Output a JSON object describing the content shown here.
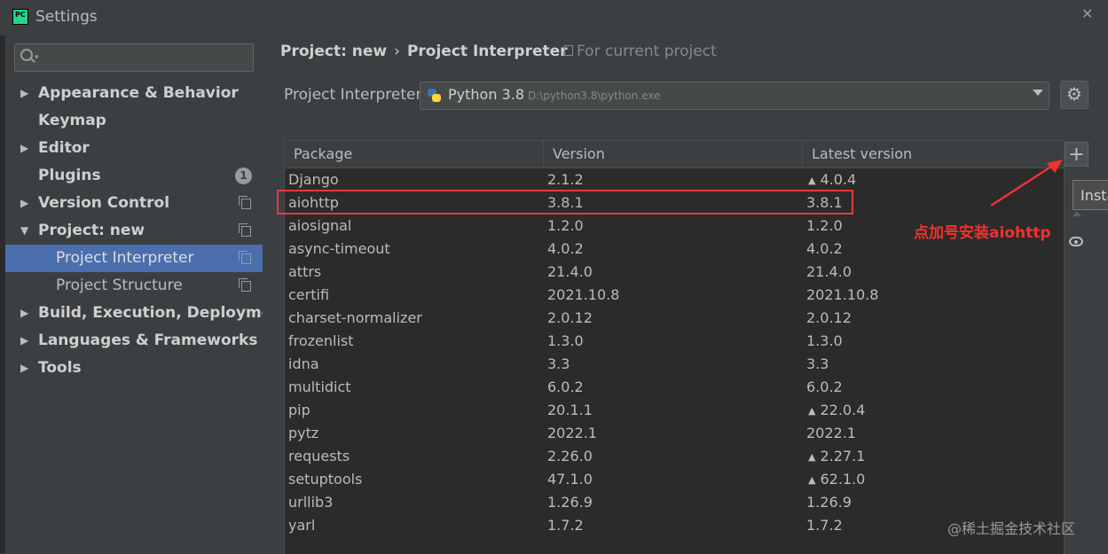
{
  "window": {
    "title": "Settings",
    "close_glyph": "✕",
    "app_icon_text": "PC"
  },
  "sidebar": {
    "search": {
      "placeholder": ""
    },
    "items": [
      {
        "label": "Appearance & Behavior",
        "arrow": "▶"
      },
      {
        "label": "Keymap",
        "arrow": ""
      },
      {
        "label": "Editor",
        "arrow": "▶"
      },
      {
        "label": "Plugins",
        "arrow": "",
        "badge": "1"
      },
      {
        "label": "Version Control",
        "arrow": "▶"
      },
      {
        "label": "Project: new",
        "arrow": "▼"
      },
      {
        "label": "Project Interpreter",
        "selected": true
      },
      {
        "label": "Project Structure"
      },
      {
        "label": "Build, Execution, Deployment",
        "arrow": "▶"
      },
      {
        "label": "Languages & Frameworks",
        "arrow": "▶"
      },
      {
        "label": "Tools",
        "arrow": "▶"
      }
    ]
  },
  "header": {
    "breadcrumb_project": "Project: new",
    "breadcrumb_sep": "›",
    "breadcrumb_page": "Project Interpreter",
    "scope": "For current project"
  },
  "interpreter": {
    "label": "Project Interpreter:",
    "name": "Python 3.8",
    "path": "D:\\python3.8\\python.exe"
  },
  "table": {
    "headers": [
      "Package",
      "Version",
      "Latest version"
    ],
    "rows": [
      {
        "package": "Django",
        "version": "2.1.2",
        "latest": "4.0.4",
        "upgrade": true
      },
      {
        "package": "aiohttp",
        "version": "3.8.1",
        "latest": "3.8.1",
        "upgrade": false
      },
      {
        "package": "aiosignal",
        "version": "1.2.0",
        "latest": "1.2.0",
        "upgrade": false
      },
      {
        "package": "async-timeout",
        "version": "4.0.2",
        "latest": "4.0.2",
        "upgrade": false
      },
      {
        "package": "attrs",
        "version": "21.4.0",
        "latest": "21.4.0",
        "upgrade": false
      },
      {
        "package": "certifi",
        "version": "2021.10.8",
        "latest": "2021.10.8",
        "upgrade": false
      },
      {
        "package": "charset-normalizer",
        "version": "2.0.12",
        "latest": "2.0.12",
        "upgrade": false
      },
      {
        "package": "frozenlist",
        "version": "1.3.0",
        "latest": "1.3.0",
        "upgrade": false
      },
      {
        "package": "idna",
        "version": "3.3",
        "latest": "3.3",
        "upgrade": false
      },
      {
        "package": "multidict",
        "version": "6.0.2",
        "latest": "6.0.2",
        "upgrade": false
      },
      {
        "package": "pip",
        "version": "20.1.1",
        "latest": "22.0.4",
        "upgrade": true
      },
      {
        "package": "pytz",
        "version": "2022.1",
        "latest": "2022.1",
        "upgrade": false
      },
      {
        "package": "requests",
        "version": "2.26.0",
        "latest": "2.27.1",
        "upgrade": true
      },
      {
        "package": "setuptools",
        "version": "47.1.0",
        "latest": "62.1.0",
        "upgrade": true
      },
      {
        "package": "urllib3",
        "version": "1.26.9",
        "latest": "1.26.9",
        "upgrade": false
      },
      {
        "package": "yarl",
        "version": "1.7.2",
        "latest": "1.7.2",
        "upgrade": false
      }
    ],
    "upgrade_glyph": "▲"
  },
  "tools": {
    "add_glyph": "+",
    "tooltip": "Insta"
  },
  "annotation": {
    "text": "点加号安装aiohttp",
    "color": "#f2312f"
  },
  "watermark": "@稀土掘金技术社区",
  "colors": {
    "selection": "#4b6eaf",
    "background": "#3c3f41",
    "table_bg": "#2b2b2b"
  }
}
